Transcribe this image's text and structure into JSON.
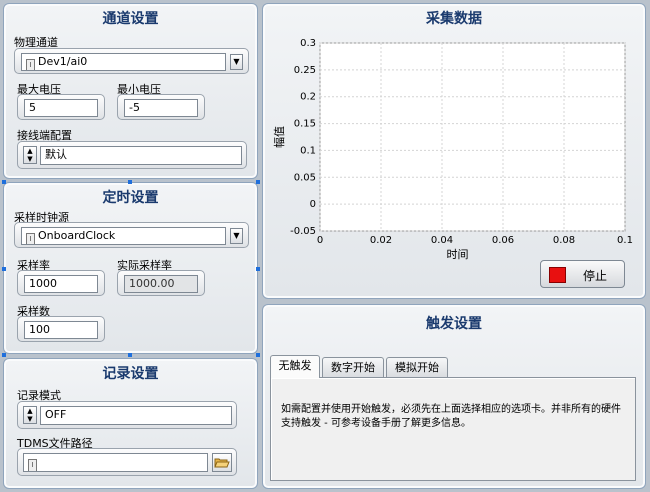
{
  "channel_settings": {
    "title": "通道设置",
    "physical_channel_label": "物理通道",
    "physical_channel_value": "Dev1/ai0",
    "max_voltage_label": "最大电压",
    "max_voltage_value": "5",
    "min_voltage_label": "最小电压",
    "min_voltage_value": "-5",
    "terminal_config_label": "接线端配置",
    "terminal_config_value": "默认"
  },
  "timing_settings": {
    "title": "定时设置",
    "clock_source_label": "采样时钟源",
    "clock_source_value": "OnboardClock",
    "sample_rate_label": "采样率",
    "sample_rate_value": "1000",
    "actual_rate_label": "实际采样率",
    "actual_rate_value": "1000.00",
    "samples_label": "采样数",
    "samples_value": "100"
  },
  "logging_settings": {
    "title": "记录设置",
    "mode_label": "记录模式",
    "mode_value": "OFF",
    "tdms_path_label": "TDMS文件路径",
    "tdms_path_value": ""
  },
  "acquire": {
    "title": "采集数据",
    "stop_label": "停止"
  },
  "trigger_settings": {
    "title": "触发设置",
    "tabs": [
      "无触发",
      "数字开始",
      "模拟开始"
    ],
    "active_tab": 0,
    "description": "如需配置并使用开始触发，必须先在上面选择相应的选项卡。并非所有的硬件支持触发 - 可参考设备手册了解更多信息。"
  },
  "colors": {
    "stop_indicator": "#e81010",
    "panel_title": "#1a3a6e",
    "background": "#b9c2cc"
  },
  "chart_data": {
    "type": "line",
    "xlabel": "时间",
    "ylabel": "幅值",
    "xlim": [
      0,
      0.1
    ],
    "ylim": [
      -0.05,
      0.3
    ],
    "x_ticks": [
      "0",
      "0.02",
      "0.04",
      "0.06",
      "0.08",
      "0.1"
    ],
    "y_ticks": [
      "0.3",
      "0.25",
      "0.2",
      "0.15",
      "0.1",
      "0.05",
      "0",
      "-0.05"
    ],
    "grid": true,
    "series": []
  }
}
